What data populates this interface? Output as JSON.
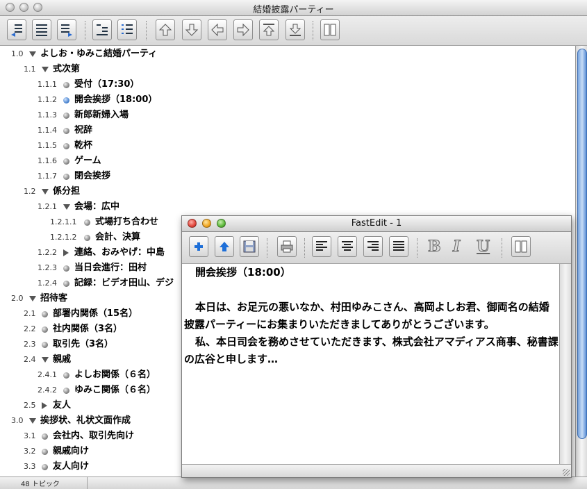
{
  "window": {
    "title": "結婚披露パーティー"
  },
  "status": {
    "topics": "48 トピック"
  },
  "outline": [
    {
      "num": "1.0",
      "label": "よしお・ゆみこ結婚パーティ",
      "depth": 0,
      "marker": "open"
    },
    {
      "num": "1.1",
      "label": "式次第",
      "depth": 1,
      "marker": "open"
    },
    {
      "num": "1.1.1",
      "label": "受付（17:30）",
      "depth": 2,
      "marker": "dot"
    },
    {
      "num": "1.1.2",
      "label": "開会挨拶（18:00）",
      "depth": 2,
      "marker": "dot-blue"
    },
    {
      "num": "1.1.3",
      "label": "新郎新婦入場",
      "depth": 2,
      "marker": "dot"
    },
    {
      "num": "1.1.4",
      "label": "祝辞",
      "depth": 2,
      "marker": "dot"
    },
    {
      "num": "1.1.5",
      "label": "乾杯",
      "depth": 2,
      "marker": "dot"
    },
    {
      "num": "1.1.6",
      "label": "ゲーム",
      "depth": 2,
      "marker": "dot"
    },
    {
      "num": "1.1.7",
      "label": "閉会挨拶",
      "depth": 2,
      "marker": "dot"
    },
    {
      "num": "1.2",
      "label": "係分担",
      "depth": 1,
      "marker": "open"
    },
    {
      "num": "1.2.1",
      "label": "会場：広中",
      "depth": 2,
      "marker": "open"
    },
    {
      "num": "1.2.1.1",
      "label": "式場打ち合わせ",
      "depth": 3,
      "marker": "dot"
    },
    {
      "num": "1.2.1.2",
      "label": "会計、決算",
      "depth": 3,
      "marker": "dot"
    },
    {
      "num": "1.2.2",
      "label": "連絡、おみやげ：中島",
      "depth": 2,
      "marker": "closed"
    },
    {
      "num": "1.2.3",
      "label": "当日会進行：田村",
      "depth": 2,
      "marker": "dot"
    },
    {
      "num": "1.2.4",
      "label": "記録：ビデオ田山、デジ",
      "depth": 2,
      "marker": "dot"
    },
    {
      "num": "2.0",
      "label": "招待客",
      "depth": 0,
      "marker": "open"
    },
    {
      "num": "2.1",
      "label": "部署内関係（15名）",
      "depth": 1,
      "marker": "dot"
    },
    {
      "num": "2.2",
      "label": "社内関係（3名）",
      "depth": 1,
      "marker": "dot"
    },
    {
      "num": "2.3",
      "label": "取引先（3名）",
      "depth": 1,
      "marker": "dot"
    },
    {
      "num": "2.4",
      "label": "親戚",
      "depth": 1,
      "marker": "open"
    },
    {
      "num": "2.4.1",
      "label": "よしお関係（６名）",
      "depth": 2,
      "marker": "dot"
    },
    {
      "num": "2.4.2",
      "label": "ゆみこ関係（６名）",
      "depth": 2,
      "marker": "dot"
    },
    {
      "num": "2.5",
      "label": "友人",
      "depth": 1,
      "marker": "closed"
    },
    {
      "num": "3.0",
      "label": "挨拶状、礼状文面作成",
      "depth": 0,
      "marker": "open"
    },
    {
      "num": "3.1",
      "label": "会社内、取引先向け",
      "depth": 1,
      "marker": "dot"
    },
    {
      "num": "3.2",
      "label": "親戚向け",
      "depth": 1,
      "marker": "dot"
    },
    {
      "num": "3.3",
      "label": "友人向け",
      "depth": 1,
      "marker": "dot"
    }
  ],
  "fastedit": {
    "title": "FastEdit - 1",
    "heading": "開会挨拶（18:00）",
    "para1": "本日は、お足元の悪いなか、村田ゆみこさん、高岡よしお君、御両名の結婚披露パーティーにお集まりいただきましてありがとうございます。",
    "para2": "私、本日司会を務めさせていただきます、株式会社アマディアス商事、秘書課の広谷と申します…"
  }
}
